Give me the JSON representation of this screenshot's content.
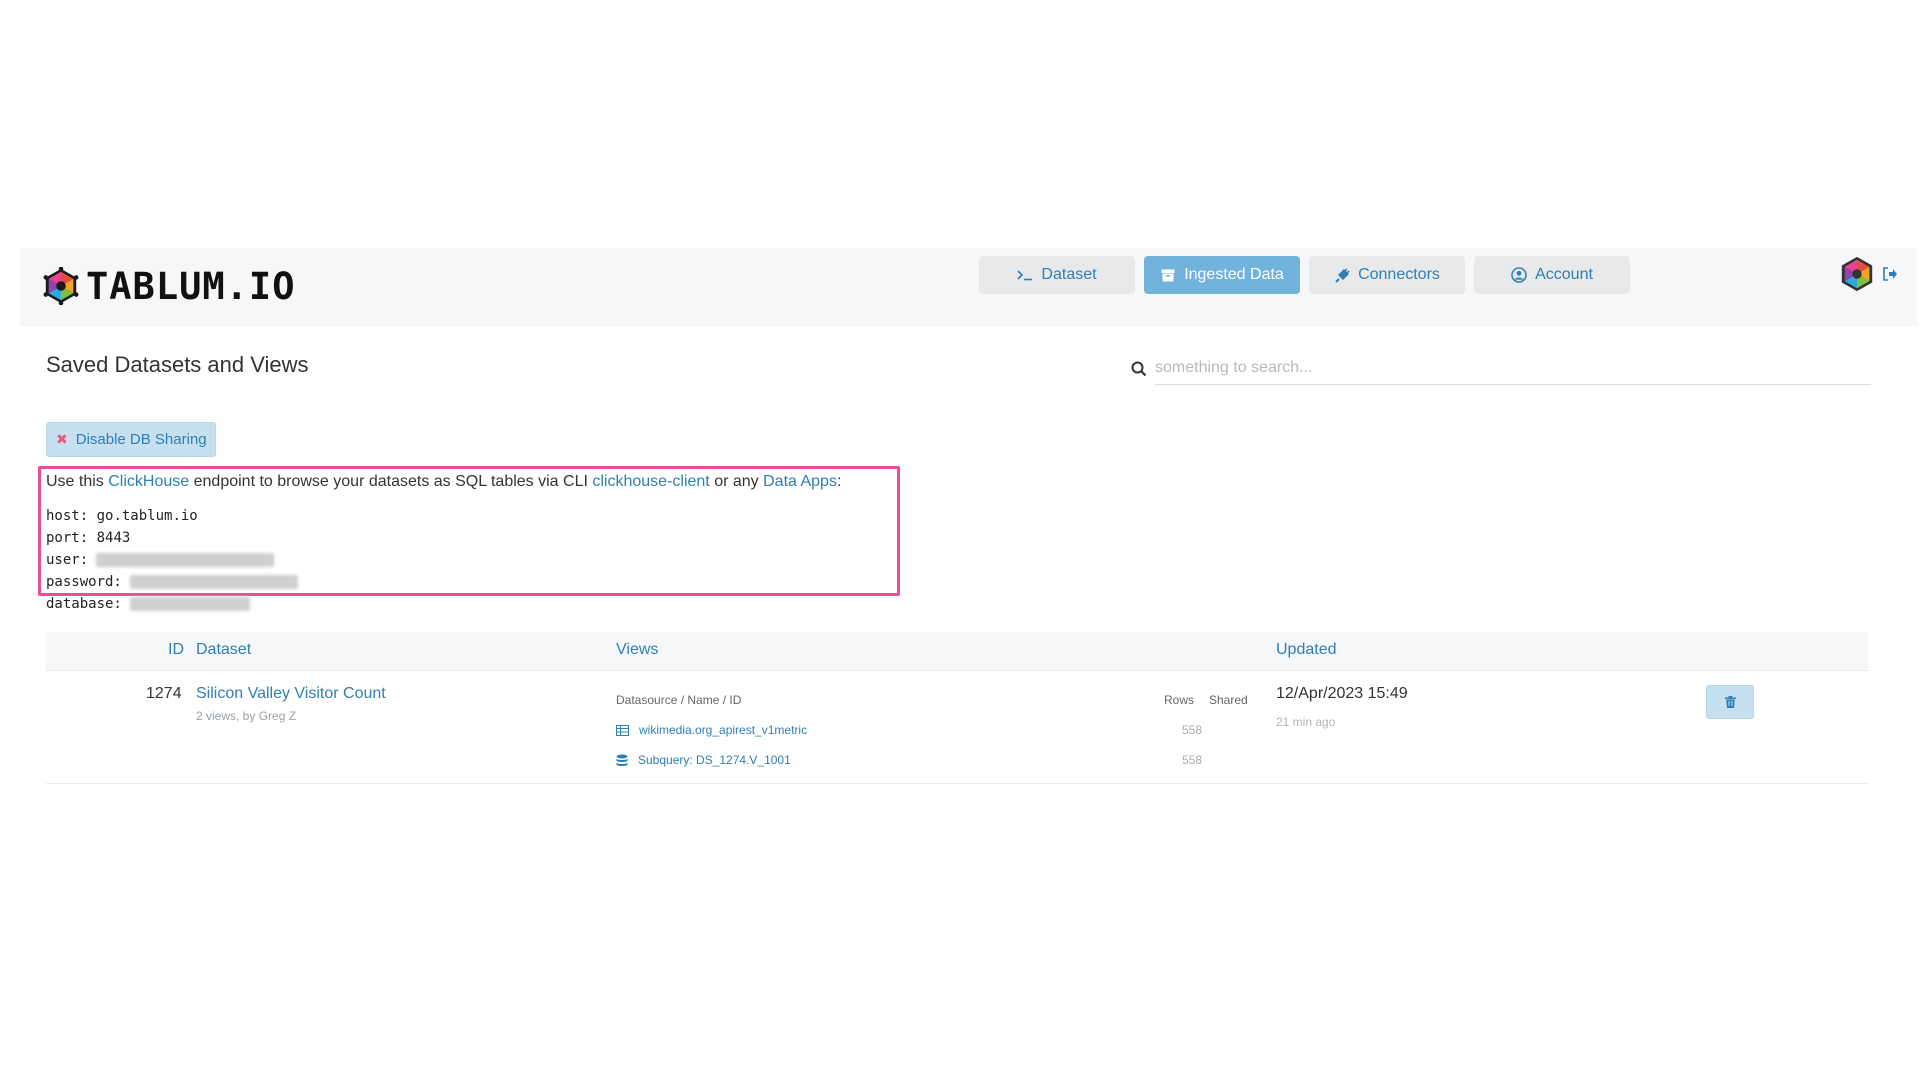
{
  "brand": {
    "name": "TABLUM.IO"
  },
  "nav": {
    "items": [
      {
        "label": "Dataset",
        "icon": "terminal-icon"
      },
      {
        "label": "Ingested Data",
        "icon": "archive-icon",
        "active": true
      },
      {
        "label": "Connectors",
        "icon": "plug-icon"
      },
      {
        "label": "Account",
        "icon": "user-circle-icon"
      }
    ]
  },
  "page": {
    "title": "Saved Datasets and Views"
  },
  "search": {
    "placeholder": "something to search..."
  },
  "sharing": {
    "button_label": "Disable DB Sharing"
  },
  "endpoint": {
    "text_1": "Use this ",
    "link_clickhouse": "ClickHouse",
    "text_2": " endpoint to browse your datasets as SQL tables via CLI ",
    "link_client": "clickhouse-client",
    "text_3": " or any ",
    "link_apps": "Data Apps",
    "text_4": ":",
    "host_label": "host:",
    "host_value": "go.tablum.io",
    "port_label": "port:",
    "port_value": "8443",
    "user_label": "user:",
    "password_label": "password:",
    "database_label": "database:"
  },
  "table": {
    "headers": {
      "id": "ID",
      "dataset": "Dataset",
      "views": "Views",
      "updated": "Updated"
    },
    "rows": [
      {
        "id": "1274",
        "name": "Silicon Valley Visitor Count",
        "sub": "2 views, by Greg Z",
        "views_header": "Datasource / Name / ID",
        "rows_header": "Rows",
        "shared_header": "Shared",
        "views": [
          {
            "label": "wikimedia.org_apirest_v1metric",
            "icon": "table-icon",
            "rows": "558"
          },
          {
            "label": "Subquery: DS_1274.V_1001",
            "icon": "database-icon",
            "rows": "558"
          }
        ],
        "updated": "12/Apr/2023 15:49",
        "ago": "21 min ago"
      }
    ]
  },
  "colors": {
    "accent": "#2f7fb4",
    "active_nav": "#72b3de",
    "highlight_border": "#ea4d9a",
    "button_bg": "#c6e0f0"
  }
}
